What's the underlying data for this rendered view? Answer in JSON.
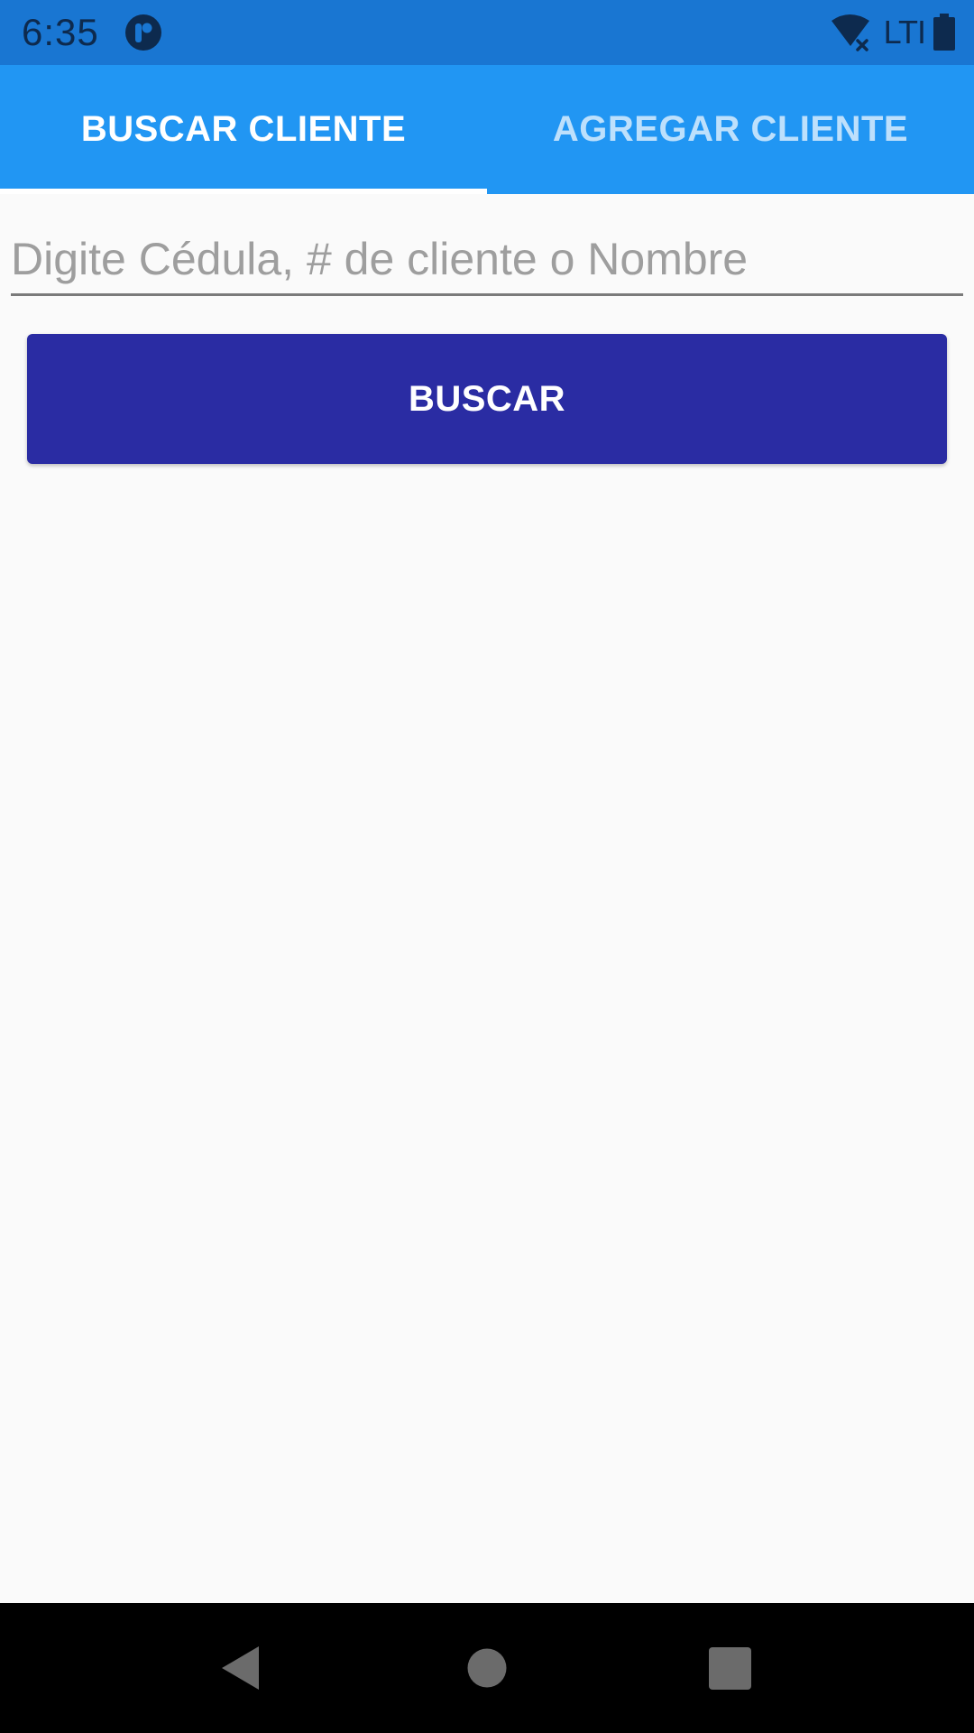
{
  "status_bar": {
    "time": "6:35",
    "network_label": "LTI",
    "icons": [
      "app-notification-icon",
      "wifi-off-icon",
      "battery-icon"
    ]
  },
  "tabs": [
    {
      "label": "BUSCAR CLIENTE",
      "active": true
    },
    {
      "label": "AGREGAR CLIENTE",
      "active": false
    }
  ],
  "search": {
    "placeholder": "Digite Cédula, # de cliente o Nombre",
    "value": ""
  },
  "buscar_button": {
    "label": "BUSCAR"
  },
  "nav_bar": {
    "icons": [
      "back-icon",
      "home-icon",
      "recents-icon"
    ]
  },
  "colors": {
    "status_bar": "#1976d2",
    "tab_bar": "#2196f3",
    "button": "#2a2ca3",
    "background": "#fafafa",
    "nav_bar": "#000000"
  }
}
